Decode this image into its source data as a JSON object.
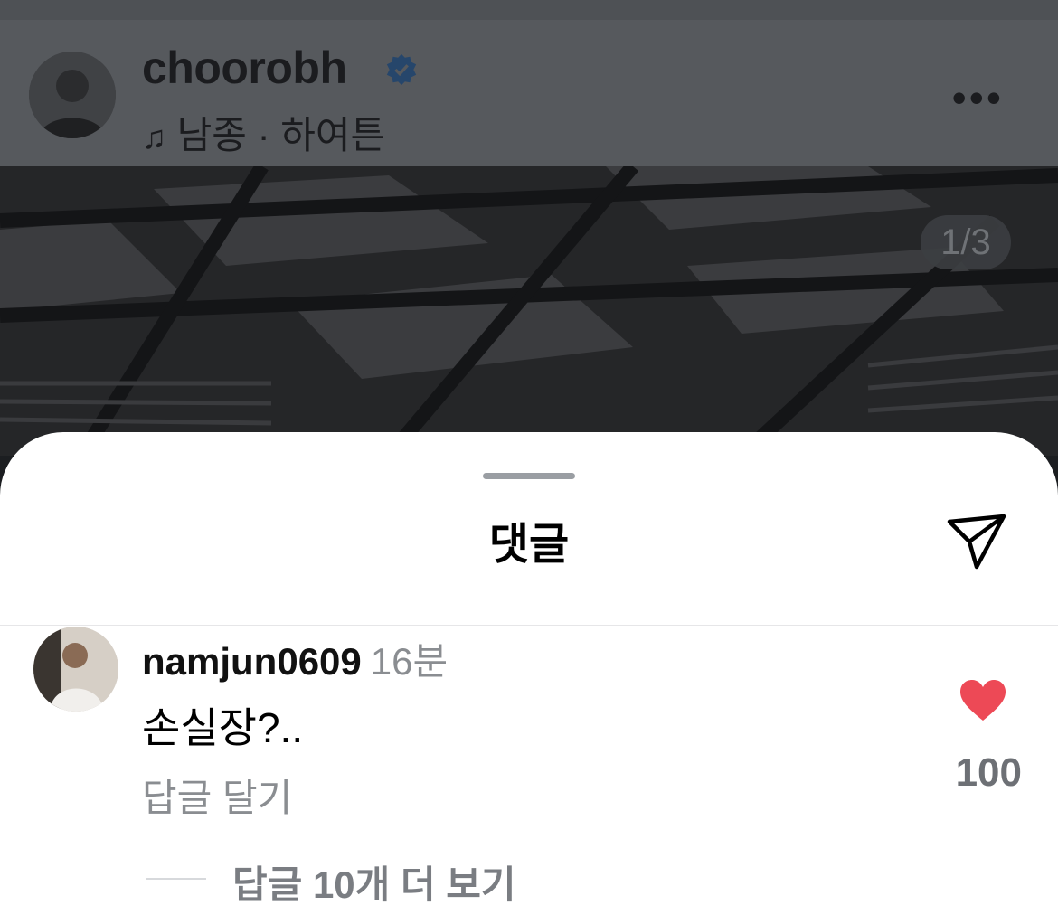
{
  "post": {
    "username": "choorobh",
    "music_icon": "music-note-icon",
    "music": "남종 · 하여튼",
    "more": "•••",
    "counter": "1/3"
  },
  "sheet": {
    "title": "댓글",
    "share_icon": "paper-plane-icon"
  },
  "comment": {
    "username": "namjun0609",
    "time": "16분",
    "text": "손실장?..",
    "reply_label": "답글 달기",
    "likes": "100",
    "like_icon": "heart-filled-icon",
    "like_color": "#ed4956",
    "view_more_replies": "답글 10개 더 보기"
  }
}
